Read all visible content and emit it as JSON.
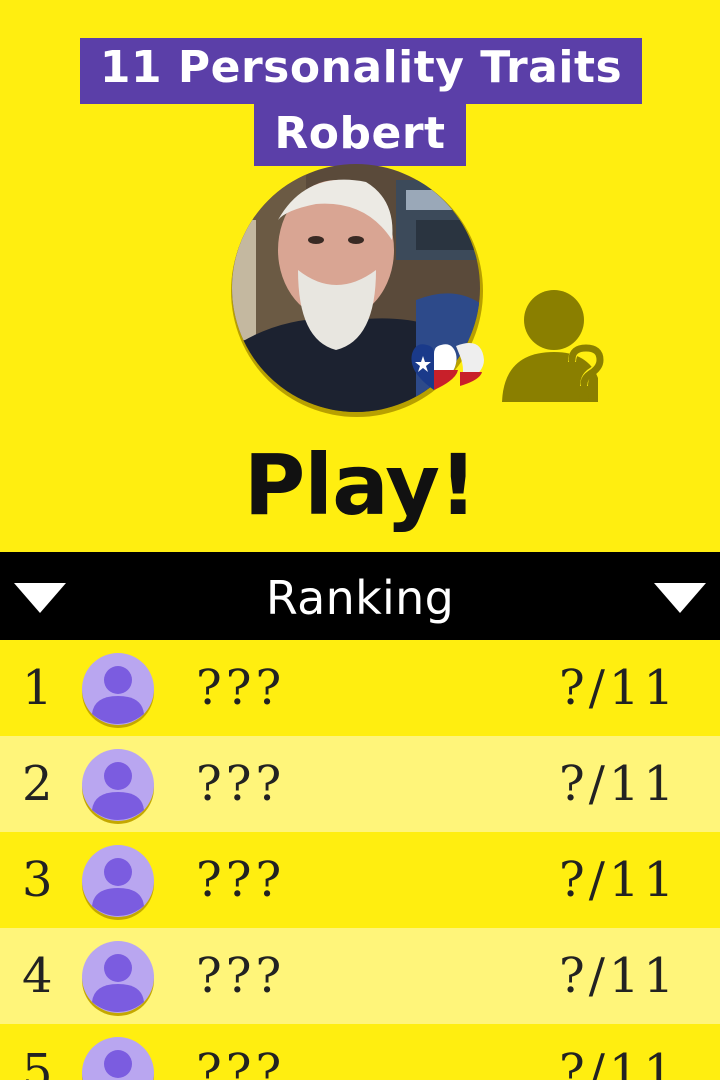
{
  "header": {
    "title_line1": "11 Personality Traits",
    "title_line2": "Robert"
  },
  "profile": {
    "flag_icon": "texas-flag-heart-icon",
    "unknown_player_icon": "unknown-user-question-icon"
  },
  "play": {
    "label": "Play!"
  },
  "ranking": {
    "title": "Ranking",
    "rows": [
      {
        "rank": "1",
        "name": "???",
        "score": "?/11"
      },
      {
        "rank": "2",
        "name": "???",
        "score": "?/11"
      },
      {
        "rank": "3",
        "name": "???",
        "score": "?/11"
      },
      {
        "rank": "4",
        "name": "???",
        "score": "?/11"
      },
      {
        "rank": "5",
        "name": "???",
        "score": "?/11"
      }
    ]
  },
  "colors": {
    "background": "#ffee10",
    "row_alt": "#fff57a",
    "title_bg": "#5b3fa8",
    "ranking_bar": "#000000",
    "avatar_purple": "#7b5ce0",
    "unknown_icon": "#8a7f00"
  }
}
